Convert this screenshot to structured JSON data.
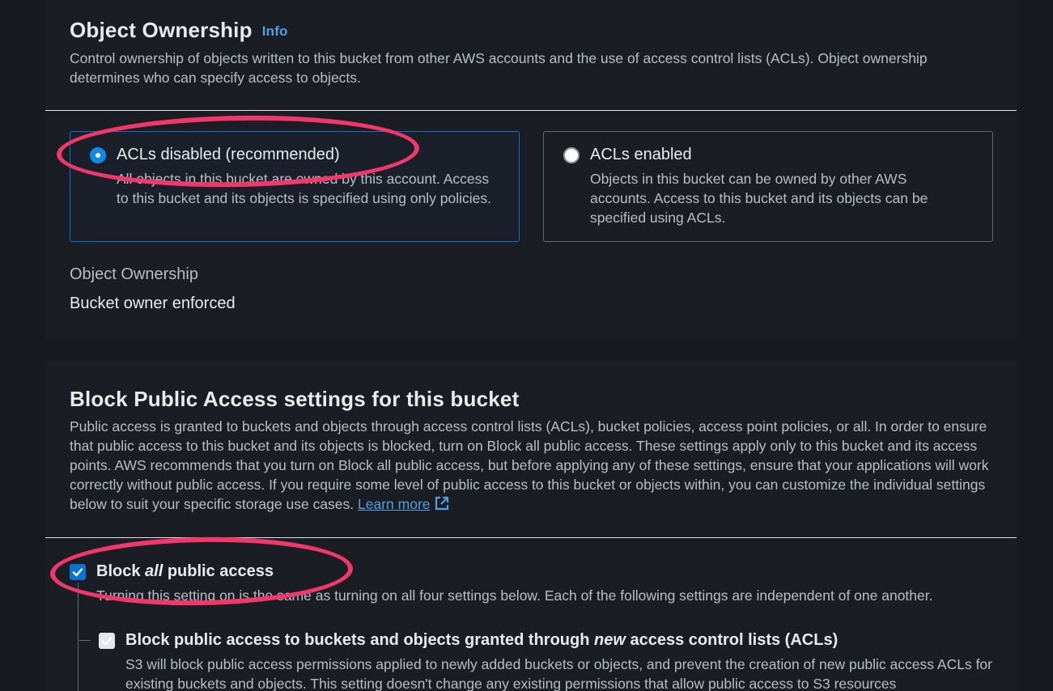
{
  "object_ownership": {
    "title": "Object Ownership",
    "info_label": "Info",
    "description": "Control ownership of objects written to this bucket from other AWS accounts and the use of access control lists (ACLs). Object ownership determines who can specify access to objects.",
    "options": [
      {
        "label": "ACLs disabled (recommended)",
        "description": "All objects in this bucket are owned by this account. Access to this bucket and its objects is specified using only policies.",
        "selected": true
      },
      {
        "label": "ACLs enabled",
        "description": "Objects in this bucket can be owned by other AWS accounts. Access to this bucket and its objects can be specified using ACLs.",
        "selected": false
      }
    ],
    "setting_key": "Object Ownership",
    "setting_value": "Bucket owner enforced"
  },
  "block_public_access": {
    "title": "Block Public Access settings for this bucket",
    "description": "Public access is granted to buckets and objects through access control lists (ACLs), bucket policies, access point policies, or all. In order to ensure that public access to this bucket and its objects is blocked, turn on Block all public access. These settings apply only to this bucket and its access points. AWS recommends that you turn on Block all public access, but before applying any of these settings, ensure that your applications will work correctly without public access. If you require some level of public access to this bucket or objects within, you can customize the individual settings below to suit your specific storage use cases.",
    "learn_more_label": "Learn more",
    "block_all": {
      "label_prefix": "Block ",
      "label_em": "all",
      "label_suffix": " public access",
      "checked": true,
      "description": "Turning this setting on is the same as turning on all four settings below. Each of the following settings are independent of one another."
    },
    "sub_settings": [
      {
        "label_prefix": "Block public access to buckets and objects granted through ",
        "label_em": "new",
        "label_suffix": " access control lists (ACLs)",
        "checked": true,
        "description": "S3 will block public access permissions applied to newly added buckets or objects, and prevent the creation of new public access ACLs for existing buckets and objects. This setting doesn't change any existing permissions that allow public access to S3 resources"
      }
    ]
  },
  "colors": {
    "accent": "#0972d3",
    "link": "#539fe5",
    "annotation": "#f0386b",
    "background": "#16191f",
    "panel": "#1a1d23"
  }
}
